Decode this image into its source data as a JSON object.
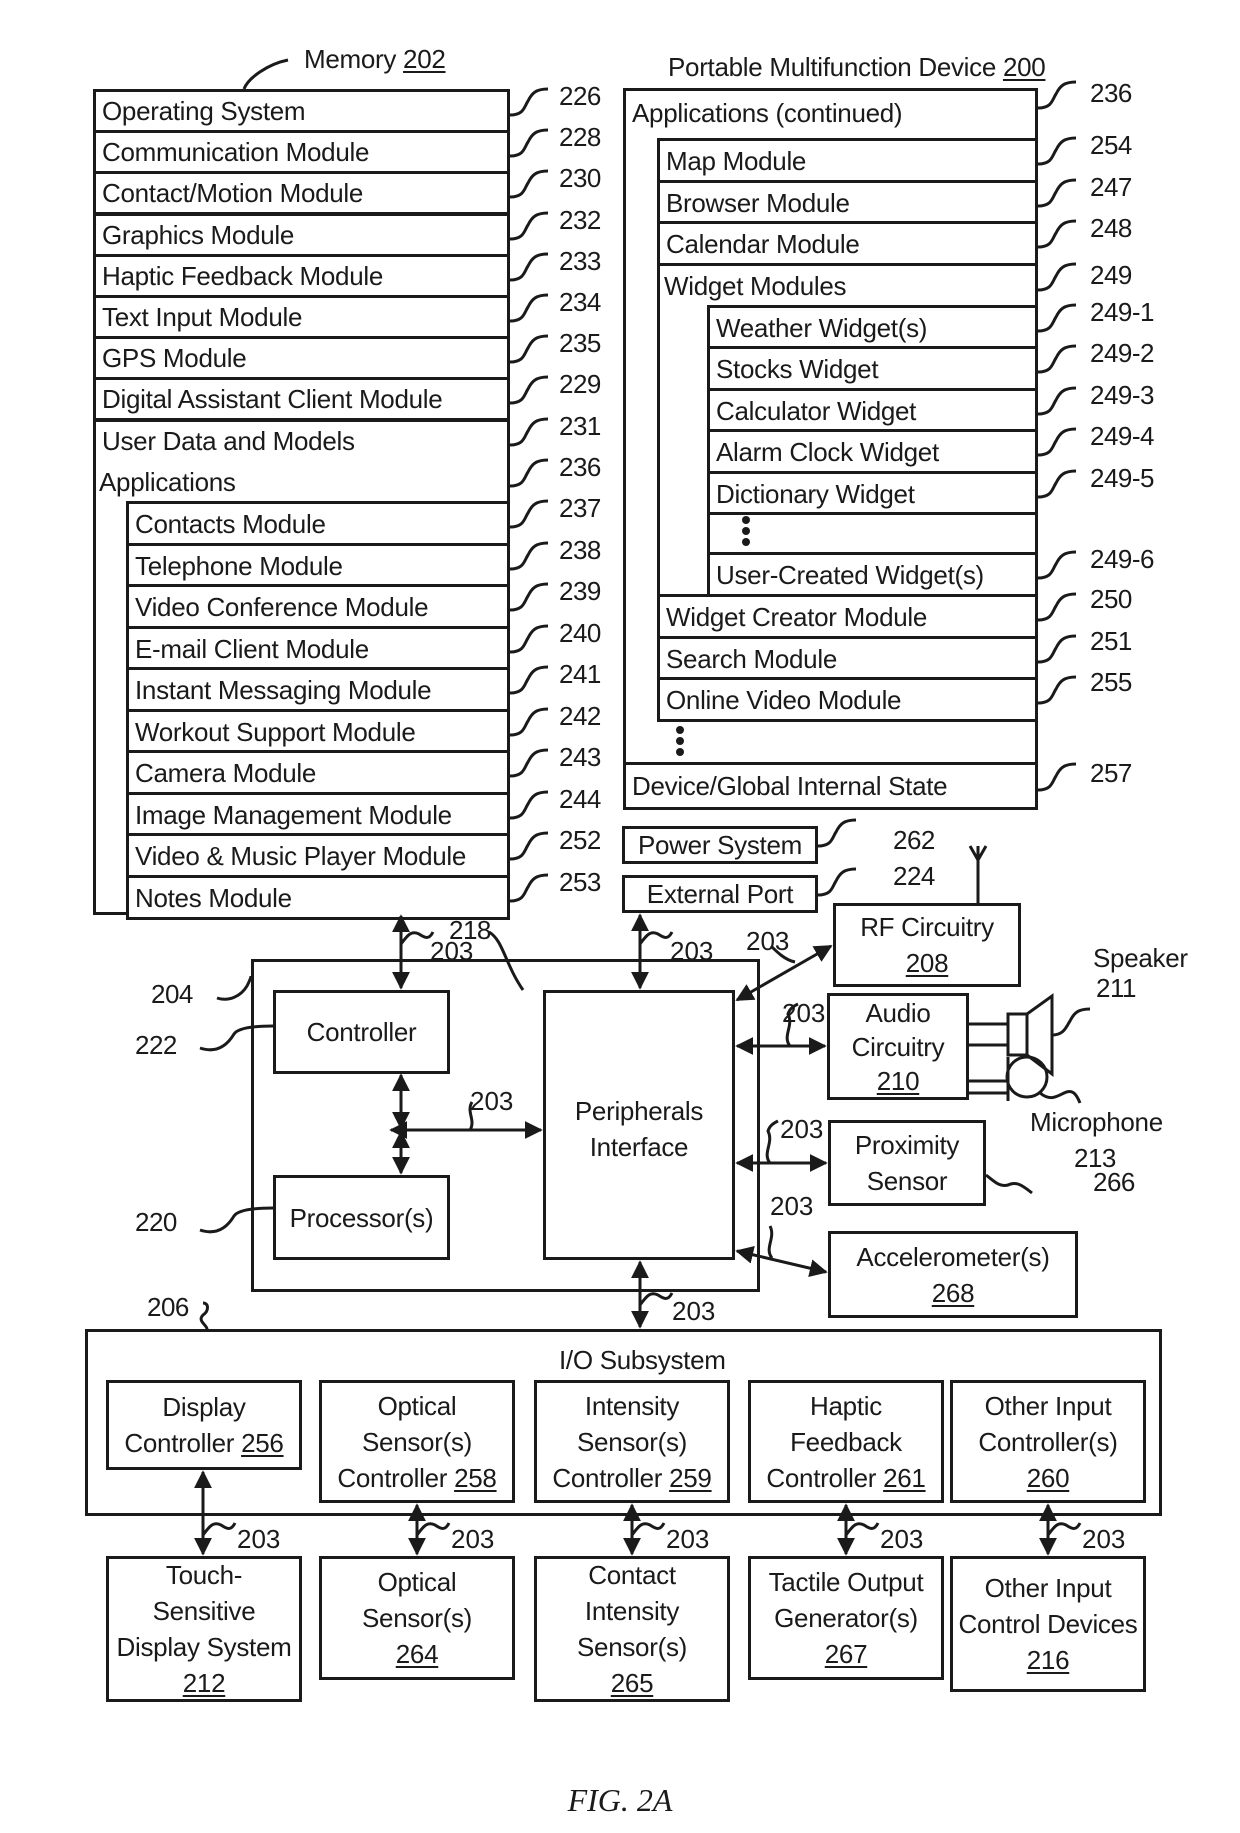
{
  "figure_label": "FIG. 2A",
  "memory": {
    "title": "Memory",
    "ref": "202",
    "modules": [
      {
        "label": "Operating System",
        "ref": "226"
      },
      {
        "label": "Communication Module",
        "ref": "228"
      },
      {
        "label": "Contact/Motion Module",
        "ref": "230"
      },
      {
        "label": "Graphics Module",
        "ref": "232"
      },
      {
        "label": "Haptic Feedback Module",
        "ref": "233"
      },
      {
        "label": "Text Input Module",
        "ref": "234"
      },
      {
        "label": "GPS Module",
        "ref": "235"
      },
      {
        "label": "Digital Assistant Client Module",
        "ref": "229"
      },
      {
        "label": "User Data and Models",
        "ref": "231"
      }
    ],
    "applications": {
      "label": "Applications",
      "ref": "236",
      "items": [
        {
          "label": "Contacts Module",
          "ref": "237"
        },
        {
          "label": "Telephone Module",
          "ref": "238"
        },
        {
          "label": "Video Conference Module",
          "ref": "239"
        },
        {
          "label": "E-mail Client Module",
          "ref": "240"
        },
        {
          "label": "Instant Messaging Module",
          "ref": "241"
        },
        {
          "label": "Workout Support Module",
          "ref": "242"
        },
        {
          "label": "Camera Module",
          "ref": "243"
        },
        {
          "label": "Image Management Module",
          "ref": "244"
        },
        {
          "label": "Video & Music Player Module",
          "ref": "252"
        },
        {
          "label": "Notes Module",
          "ref": "253"
        }
      ]
    }
  },
  "device": {
    "title": "Portable Multifunction Device",
    "ref": "200",
    "applications_continued": {
      "label": "Applications (continued)",
      "ref": "236",
      "items": [
        {
          "label": "Map Module",
          "ref": "254"
        },
        {
          "label": "Browser Module",
          "ref": "247"
        },
        {
          "label": "Calendar Module",
          "ref": "248"
        }
      ],
      "widget_modules": {
        "label": "Widget Modules",
        "ref": "249",
        "items": [
          {
            "label": "Weather Widget(s)",
            "ref": "249-1"
          },
          {
            "label": "Stocks Widget",
            "ref": "249-2"
          },
          {
            "label": "Calculator Widget",
            "ref": "249-3"
          },
          {
            "label": "Alarm Clock Widget",
            "ref": "249-4"
          },
          {
            "label": "Dictionary Widget",
            "ref": "249-5"
          },
          {
            "label": "User-Created Widget(s)",
            "ref": "249-6"
          }
        ]
      },
      "items_after": [
        {
          "label": "Widget Creator Module",
          "ref": "250"
        },
        {
          "label": "Search Module",
          "ref": "251"
        },
        {
          "label": "Online Video Module",
          "ref": "255"
        }
      ]
    },
    "internal_state": {
      "label": "Device/Global Internal State",
      "ref": "257"
    }
  },
  "power_system": {
    "label": "Power System",
    "ref": "262"
  },
  "external_port": {
    "label": "External Port",
    "ref": "224"
  },
  "rf_circuitry": {
    "label": "RF Circuitry",
    "ref": "208"
  },
  "audio_circuitry": {
    "line1": "Audio",
    "line2": "Circuitry",
    "ref": "210"
  },
  "speaker": {
    "label": "Speaker",
    "ref": "211"
  },
  "microphone": {
    "label": "Microphone",
    "ref": "213"
  },
  "proximity_sensor": {
    "line1": "Proximity",
    "line2": "Sensor",
    "ref": "266"
  },
  "accelerometer": {
    "label": "Accelerometer(s)",
    "ref": "268"
  },
  "chip": {
    "ref": "204",
    "controller": {
      "label": "Controller",
      "ref": "222"
    },
    "processor": {
      "label": "Processor(s)",
      "ref": "220"
    },
    "peripherals": {
      "line1": "Peripherals",
      "line2": "Interface",
      "ref": "218"
    }
  },
  "bus_ref": "203",
  "io_subsystem": {
    "label": "I/O Subsystem",
    "ref": "206",
    "controllers": [
      {
        "lines": [
          "Display"
        ],
        "last": "Controller",
        "ref": "256"
      },
      {
        "lines": [
          "Optical",
          "Sensor(s)"
        ],
        "last": "Controller",
        "ref": "258"
      },
      {
        "lines": [
          "Intensity",
          "Sensor(s)"
        ],
        "last": "Controller",
        "ref": "259"
      },
      {
        "lines": [
          "Haptic",
          "Feedback"
        ],
        "last": "Controller",
        "ref": "261"
      },
      {
        "lines": [
          "Other Input",
          "Controller(s)"
        ],
        "last": "",
        "ref": "260"
      }
    ]
  },
  "devices": [
    {
      "lines": [
        "Touch-",
        "Sensitive",
        "Display System"
      ],
      "ref": "212"
    },
    {
      "lines": [
        "Optical",
        "Sensor(s)"
      ],
      "ref": "264"
    },
    {
      "lines": [
        "Contact",
        "Intensity",
        "Sensor(s)"
      ],
      "ref": "265"
    },
    {
      "lines": [
        "Tactile Output",
        "Generator(s)"
      ],
      "ref": "267"
    },
    {
      "lines": [
        "Other Input",
        "Control Devices"
      ],
      "ref": "216"
    }
  ]
}
